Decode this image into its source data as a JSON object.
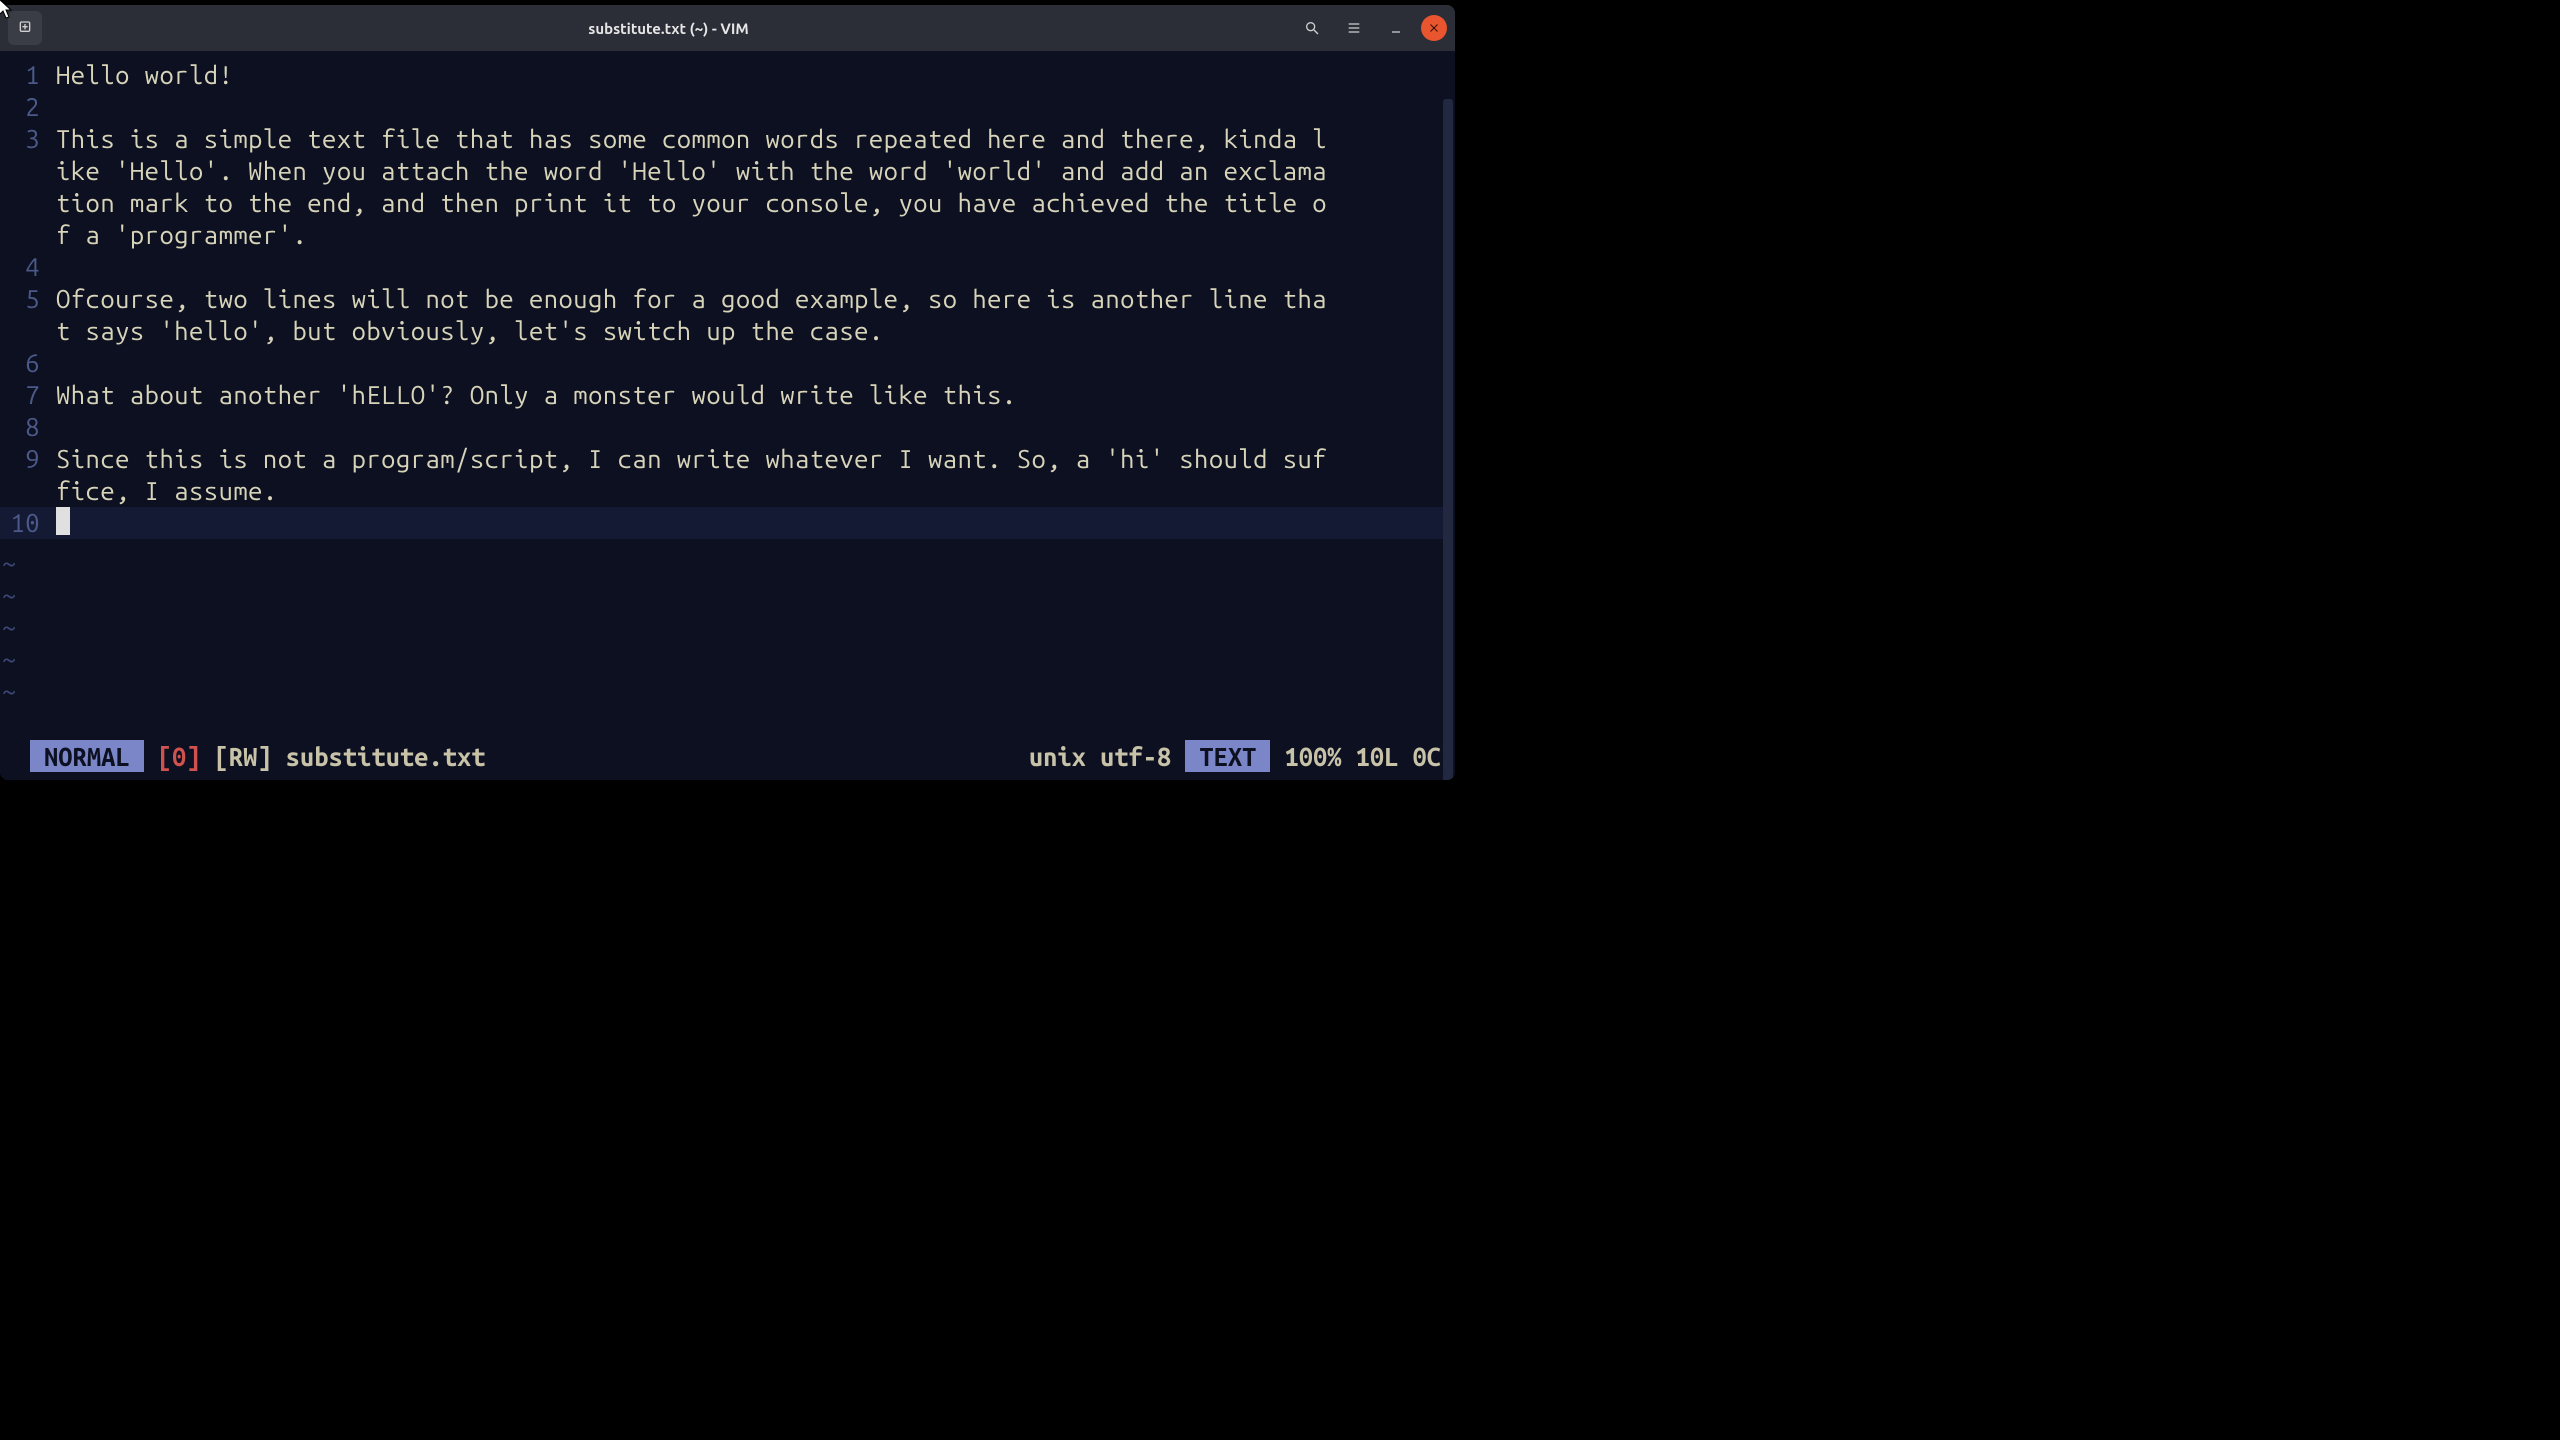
{
  "window": {
    "title": "substitute.txt (~) - VIM"
  },
  "file": {
    "lines": [
      {
        "num": "1",
        "text": "Hello world!"
      },
      {
        "num": "2",
        "text": ""
      },
      {
        "num": "3",
        "text": "This is a simple text file that has some common words repeated here and there, kinda like 'Hello'. When you attach the word 'Hello' with the word 'world' and add an exclamation mark to the end, and then print it to your console, you have achieved the title of a 'programmer'."
      },
      {
        "num": "4",
        "text": ""
      },
      {
        "num": "5",
        "text": "Ofcourse, two lines will not be enough for a good example, so here is another line that says 'hello', but obviously, let's switch up the case."
      },
      {
        "num": "6",
        "text": ""
      },
      {
        "num": "7",
        "text": "What about another 'hELLO'? Only a monster would write like this."
      },
      {
        "num": "8",
        "text": ""
      },
      {
        "num": "9",
        "text": "Since this is not a program/script, I can write whatever I want. So, a 'hi' should suffice, I assume."
      },
      {
        "num": "10",
        "text": "",
        "current": true
      }
    ]
  },
  "status": {
    "mode": "NORMAL",
    "bufnum": "[0]",
    "rw": "[RW]",
    "filename": "substitute.txt",
    "fileformat": "unix",
    "encoding": "utf-8",
    "filetype": "TEXT",
    "percent": "100%",
    "lines": "10L",
    "col": "0C"
  }
}
